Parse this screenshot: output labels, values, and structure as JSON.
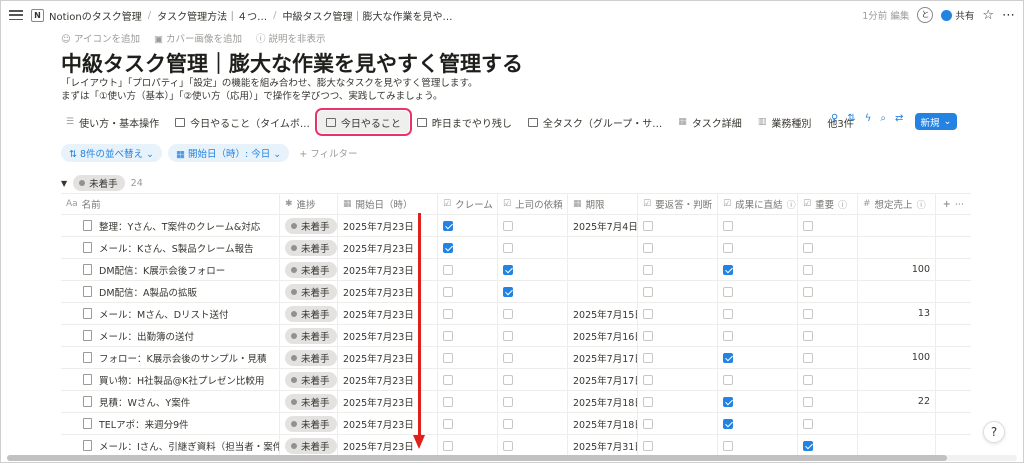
{
  "topbar": {
    "workspace_icon": "N",
    "breadcrumbs": [
      "Notionのタスク管理",
      "タスク管理方法｜４つ…",
      "中級タスク管理｜膨大な作業を見や…"
    ],
    "edited": "1分前 編集",
    "avatar": "と",
    "share": "共有"
  },
  "page": {
    "actions": [
      "アイコンを追加",
      "カバー画像を追加",
      "説明を非表示"
    ],
    "title": "中級タスク管理｜膨大な作業を見やすく管理する",
    "desc1": "「レイアウト」「プロパティ」「設定」の機能を組み合わせ、膨大なタスクを見やすく管理します。",
    "desc2": "まずは「①使い方（基本）」「②使い方（応用）」で操作を学びつつ、実践してみましょう。"
  },
  "tabs": [
    {
      "label": "使い方・基本操作",
      "icon": "list-icon"
    },
    {
      "label": "今日やること（タイムボ…",
      "icon": "table-icon"
    },
    {
      "label": "今日やること",
      "icon": "table-icon"
    },
    {
      "label": "昨日までやり残し",
      "icon": "table-icon"
    },
    {
      "label": "全タスク（グループ・サ…",
      "icon": "table-icon"
    },
    {
      "label": "タスク詳細",
      "icon": "gallery-icon"
    },
    {
      "label": "業務種別",
      "icon": "board-icon"
    },
    {
      "label": "他3件",
      "icon": ""
    }
  ],
  "new_button": "新規",
  "filters": {
    "sort": "8件の並べ替え",
    "date_filter": "開始日（時）: 今日",
    "add_filter": "+ フィルター"
  },
  "group": {
    "label": "未着手",
    "count": "24"
  },
  "columns": {
    "name": "名前",
    "progress": "進捗",
    "start": "開始日（時）",
    "claim": "クレーム",
    "boss": "上司の依頼",
    "due": "期限",
    "reply": "要返答・判断",
    "result": "成果に直結",
    "important": "重要",
    "sales": "想定売上"
  },
  "rows": [
    {
      "name": "整理：Yさん、T案件のクレーム&対応",
      "progress": "未着手",
      "start": "2025年7月23日",
      "claim": true,
      "boss": false,
      "due": "2025年7月4日",
      "reply": false,
      "result": false,
      "important": false,
      "sales": ""
    },
    {
      "name": "メール：Kさん、S製品クレーム報告",
      "progress": "未着手",
      "start": "2025年7月23日",
      "claim": true,
      "boss": false,
      "due": "",
      "reply": false,
      "result": false,
      "important": false,
      "sales": ""
    },
    {
      "name": "DM配信：K展示会後フォロー",
      "progress": "未着手",
      "start": "2025年7月23日",
      "claim": false,
      "boss": true,
      "due": "",
      "reply": false,
      "result": true,
      "important": false,
      "sales": "100"
    },
    {
      "name": "DM配信：A製品の拡販",
      "progress": "未着手",
      "start": "2025年7月23日",
      "claim": false,
      "boss": true,
      "due": "",
      "reply": false,
      "result": false,
      "important": false,
      "sales": ""
    },
    {
      "name": "メール：Mさん、Dリスト送付",
      "progress": "未着手",
      "start": "2025年7月23日",
      "claim": false,
      "boss": false,
      "due": "2025年7月15日",
      "reply": false,
      "result": false,
      "important": false,
      "sales": "13"
    },
    {
      "name": "メール：出勤簿の送付",
      "progress": "未着手",
      "start": "2025年7月23日",
      "claim": false,
      "boss": false,
      "due": "2025年7月16日",
      "reply": false,
      "result": false,
      "important": false,
      "sales": ""
    },
    {
      "name": "フォロー：K展示会後のサンプル・見積",
      "progress": "未着手",
      "start": "2025年7月23日",
      "claim": false,
      "boss": false,
      "due": "2025年7月17日",
      "reply": false,
      "result": true,
      "important": false,
      "sales": "100"
    },
    {
      "name": "買い物：H社製品@K社プレゼン比較用",
      "progress": "未着手",
      "start": "2025年7月23日",
      "claim": false,
      "boss": false,
      "due": "2025年7月17日",
      "reply": false,
      "result": false,
      "important": false,
      "sales": ""
    },
    {
      "name": "見積：Wさん、Y案件",
      "progress": "未着手",
      "start": "2025年7月23日",
      "claim": false,
      "boss": false,
      "due": "2025年7月18日",
      "reply": false,
      "result": true,
      "important": false,
      "sales": "22"
    },
    {
      "name": "TELアポ：来週分9件",
      "progress": "未着手",
      "start": "2025年7月23日",
      "claim": false,
      "boss": false,
      "due": "2025年7月18日",
      "reply": false,
      "result": true,
      "important": false,
      "sales": ""
    },
    {
      "name": "メール：Iさん、引継ぎ資料（担当者・案件・情報",
      "progress": "未着手",
      "start": "2025年7月23日",
      "claim": false,
      "boss": false,
      "due": "2025年7月31日",
      "reply": false,
      "result": false,
      "important": true,
      "sales": ""
    }
  ],
  "colors": {
    "accent": "#2383e2",
    "highlight": "#e8336b",
    "arrow": "#e0201b"
  }
}
